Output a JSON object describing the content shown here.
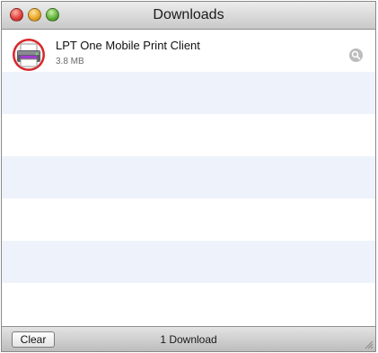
{
  "window": {
    "title": "Downloads"
  },
  "downloads": [
    {
      "name": "LPT One Mobile Print Client",
      "size": "3.8 MB",
      "icon": "printer-icon"
    }
  ],
  "statusbar": {
    "clear_label": "Clear",
    "count_text": "1 Download"
  },
  "colors": {
    "row_alt": "#eef2fb",
    "close": "#e0443e",
    "minimize": "#e9a82a",
    "zoom": "#62b33c"
  }
}
